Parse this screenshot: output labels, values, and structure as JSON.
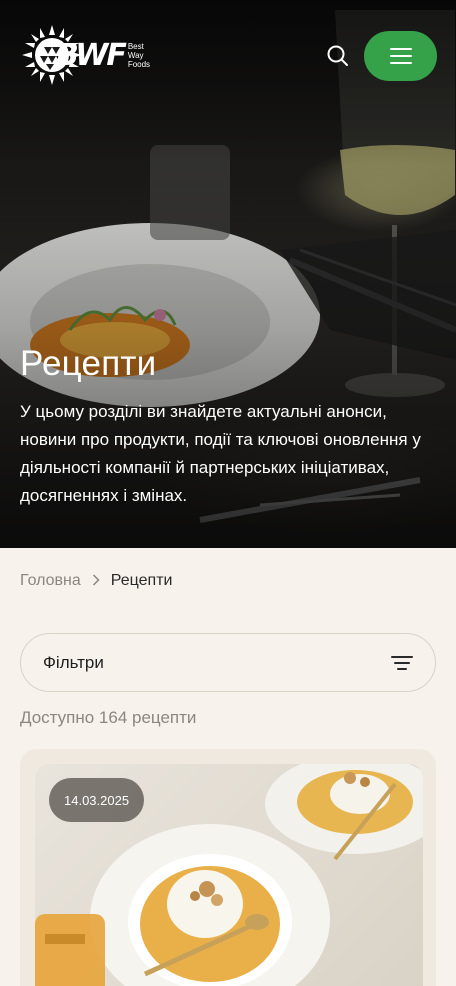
{
  "header": {
    "logo_text": "BWF",
    "logo_sub": [
      "Best",
      "Way",
      "Foods"
    ],
    "search_icon": "search-icon",
    "menu_icon": "hamburger-icon",
    "menu_color": "#35a24a"
  },
  "hero": {
    "title": "Рецепти",
    "description": "У цьому розділі ви знайдете актуальні анонси, новини про продукти, події та ключові оновлення у діяльності компанії й партнерських ініціативах, досягненнях і змінах."
  },
  "breadcrumb": {
    "home": "Головна",
    "current": "Рецепти"
  },
  "filter": {
    "label": "Фільтри",
    "icon": "filter-icon"
  },
  "results": {
    "count_text": "Доступно 164 рецепти"
  },
  "cards": [
    {
      "date": "14.03.2025"
    }
  ]
}
